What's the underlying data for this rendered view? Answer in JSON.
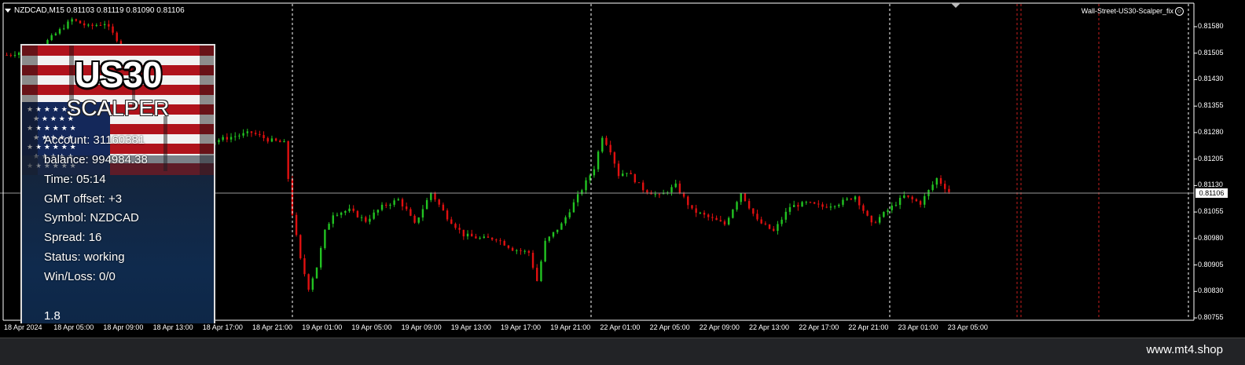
{
  "chart_header": {
    "symbol_line": "NZDCAD,M15  0.81103 0.81119 0.81090 0.81106",
    "ea_name": "Wall-Street-US30-Scalper_fix"
  },
  "panel": {
    "logo_line1": "US30",
    "logo_line2": "SCALPER",
    "info_lines": [
      "Account: 31160381",
      "balance: 994984.38",
      "Time: 05:14",
      "GMT offset: +3",
      "Symbol: NZDCAD",
      "Spread: 16",
      "Status: working",
      "Win/Loss: 0/0"
    ],
    "version": "1.8"
  },
  "current_price": "0.81106",
  "footer": {
    "site": "www.mt4.shop"
  },
  "colors": {
    "bull": "#22c322",
    "bear": "#e01010",
    "grid": "#ffffff",
    "price_line": "#a0a0a0",
    "session_line": "#c81e1e"
  },
  "chart_data": {
    "type": "candlestick",
    "symbol": "NZDCAD",
    "timeframe": "M15",
    "ohlc": {
      "open": 0.81103,
      "high": 0.81119,
      "low": 0.8109,
      "close": 0.81106
    },
    "y_ticks": [
      "0.81580",
      "0.81505",
      "0.81430",
      "0.81355",
      "0.81280",
      "0.81205",
      "0.81130",
      "0.81055",
      "0.80980",
      "0.80905",
      "0.80830",
      "0.80755"
    ],
    "ylim": [
      0.80755,
      0.8161
    ],
    "x_ticks": [
      "18 Apr 2024",
      "18 Apr 05:00",
      "18 Apr 09:00",
      "18 Apr 13:00",
      "18 Apr 17:00",
      "18 Apr 21:00",
      "19 Apr 01:00",
      "19 Apr 05:00",
      "19 Apr 09:00",
      "19 Apr 13:00",
      "19 Apr 17:00",
      "19 Apr 21:00",
      "22 Apr 01:00",
      "22 Apr 05:00",
      "22 Apr 09:00",
      "22 Apr 13:00",
      "22 Apr 17:00",
      "22 Apr 21:00",
      "23 Apr 01:00",
      "23 Apr 05:00"
    ],
    "path_points": [
      [
        0,
        0.815
      ],
      [
        8,
        0.8152
      ],
      [
        16,
        0.816
      ],
      [
        20,
        0.8158
      ],
      [
        24,
        0.8159
      ],
      [
        28,
        0.8153
      ],
      [
        32,
        0.8142
      ],
      [
        36,
        0.8133
      ],
      [
        40,
        0.813
      ],
      [
        44,
        0.8126
      ],
      [
        48,
        0.8124
      ],
      [
        52,
        0.8126
      ],
      [
        56,
        0.8127
      ],
      [
        60,
        0.8128
      ],
      [
        64,
        0.8126
      ],
      [
        68,
        0.8125
      ],
      [
        70,
        0.8105
      ],
      [
        72,
        0.8092
      ],
      [
        74,
        0.8084
      ],
      [
        76,
        0.809
      ],
      [
        78,
        0.81
      ],
      [
        80,
        0.8105
      ],
      [
        84,
        0.8106
      ],
      [
        88,
        0.8103
      ],
      [
        92,
        0.8107
      ],
      [
        96,
        0.8109
      ],
      [
        98,
        0.8106
      ],
      [
        100,
        0.8102
      ],
      [
        104,
        0.8111
      ],
      [
        108,
        0.8104
      ],
      [
        112,
        0.8099
      ],
      [
        116,
        0.8098
      ],
      [
        120,
        0.8098
      ],
      [
        124,
        0.8095
      ],
      [
        128,
        0.8094
      ],
      [
        130,
        0.8086
      ],
      [
        132,
        0.8097
      ],
      [
        136,
        0.8102
      ],
      [
        140,
        0.811
      ],
      [
        144,
        0.8118
      ],
      [
        146,
        0.8127
      ],
      [
        148,
        0.8123
      ],
      [
        150,
        0.8116
      ],
      [
        152,
        0.8117
      ],
      [
        156,
        0.8112
      ],
      [
        160,
        0.811
      ],
      [
        164,
        0.8113
      ],
      [
        168,
        0.8106
      ],
      [
        172,
        0.8104
      ],
      [
        176,
        0.8102
      ],
      [
        180,
        0.8111
      ],
      [
        184,
        0.8103
      ],
      [
        188,
        0.81
      ],
      [
        192,
        0.8107
      ],
      [
        196,
        0.8108
      ],
      [
        200,
        0.8107
      ],
      [
        204,
        0.8108
      ],
      [
        208,
        0.811
      ],
      [
        212,
        0.8102
      ],
      [
        216,
        0.8106
      ],
      [
        220,
        0.811
      ],
      [
        224,
        0.8108
      ],
      [
        228,
        0.8115
      ],
      [
        232,
        0.811
      ]
    ],
    "path_domain": [
      0,
      232
    ]
  }
}
